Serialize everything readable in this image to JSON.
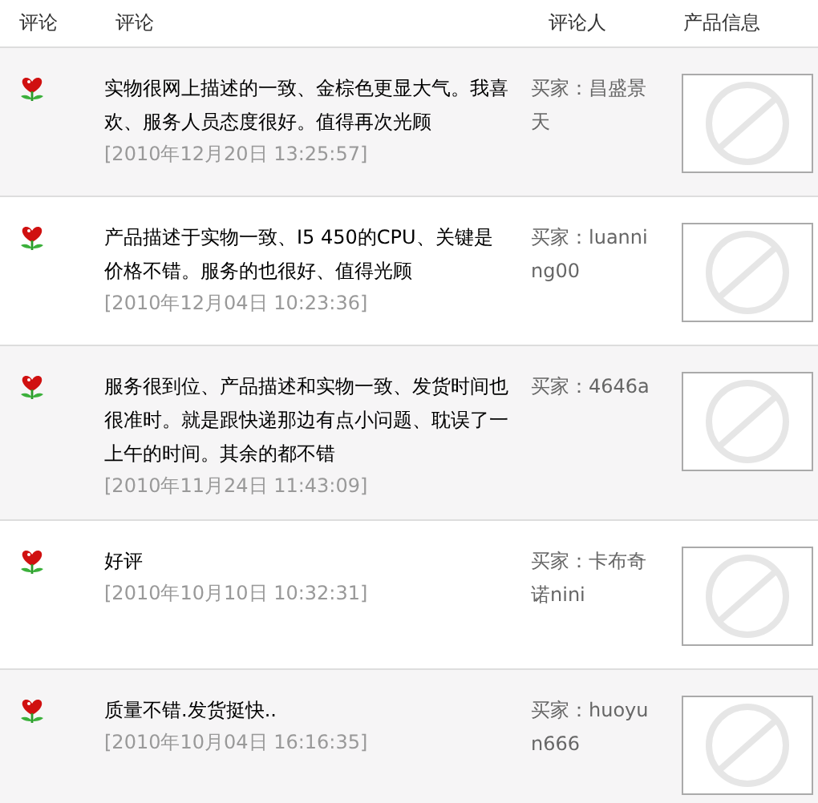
{
  "table": {
    "columns": [
      "评论",
      "评论",
      "评论人",
      "产品信息"
    ],
    "rows": [
      {
        "comment": "实物很网上描述的一致、金棕色更显大气。我喜欢、服务人员态度很好。值得再次光顾",
        "date": "[2010年12月20日 13:25:57]",
        "reviewer": "买家：昌盛景天"
      },
      {
        "comment": "产品描述于实物一致、I5 450的CPU、关键是价格不错。服务的也很好、值得光顾",
        "date": "[2010年12月04日 10:23:36]",
        "reviewer": "买家：luanning00"
      },
      {
        "comment": "服务很到位、产品描述和实物一致、发货时间也很准时。就是跟快递那边有点小问题、耽误了一上午的时间。其余的都不错",
        "date": "[2010年11月24日 11:43:09]",
        "reviewer": "买家：4646a"
      },
      {
        "comment": "好评",
        "date": "[2010年10月10日 10:32:31]",
        "reviewer": "买家：卡布奇诺nini"
      },
      {
        "comment": "质量不错.发货挺快..",
        "date": "[2010年10月04日 16:16:35]",
        "reviewer": "买家：huoyun666"
      }
    ]
  }
}
